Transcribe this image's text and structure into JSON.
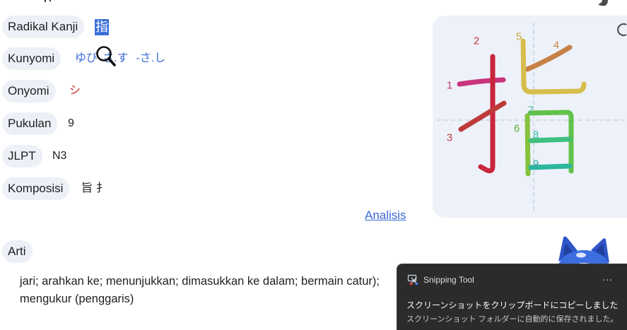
{
  "colors": {
    "text": "#202124",
    "pill_bg": "#edf0f7",
    "radical_highlight": "#3a6fd8",
    "kunyomi": "#3a6bd6",
    "onyomi": "#c62828",
    "link": "#3b67d4",
    "diagram_bg": "#edf1f9",
    "diagram_guide": "#b7c3d7",
    "notification_bg": "#2b2b2b",
    "notification_text": "#ffffff",
    "notification_subtext": "#c8c8c8",
    "mascot": "#3d6ee0"
  },
  "details": {
    "radical": {
      "label": "Radikal Kanji",
      "value": "指"
    },
    "kunyomi": {
      "label": "Kunyomi",
      "readings": [
        "ゆび",
        "さ.す",
        "-さ.し"
      ]
    },
    "onyomi": {
      "label": "Onyomi",
      "value": "シ"
    },
    "strokes": {
      "label": "Pukulan",
      "value": "9"
    },
    "jlpt": {
      "label": "JLPT",
      "value": "N3"
    },
    "composition": {
      "label": "Komposisi",
      "parts": [
        "旨",
        "扌"
      ]
    }
  },
  "analysis_link": "Analisis",
  "meaning": {
    "label": "Arti",
    "lines": [
      "jari; arahkan ke; menunjukkan; dimasukkan ke dalam; bermain catur);",
      "mengukur (penggaris)"
    ]
  },
  "stroke_diagram": {
    "replay_icon": "replay-icon",
    "strokes": [
      {
        "label": "1",
        "color": "#c8347d",
        "label_color": "#c63c78"
      },
      {
        "label": "2",
        "color": "#c8263c",
        "label_color": "#c43b3d"
      },
      {
        "label": "3",
        "color": "#bd3a3a",
        "label_color": "#c0443f"
      },
      {
        "label": "4",
        "color": "#c68146",
        "label_color": "#c8863f"
      },
      {
        "label": "5",
        "color": "#d6bd4c",
        "label_color": "#c9ab3c"
      },
      {
        "label": "6",
        "color": "#86c23e",
        "label_color": "#5daf3f"
      },
      {
        "label": "7",
        "color": "#62c14b",
        "label_color": "#45b7a5"
      },
      {
        "label": "8",
        "color": "#3fbf7d",
        "label_color": "#3cb7a9"
      },
      {
        "label": "9",
        "color": "#2db59e",
        "label_color": "#32aaa6"
      }
    ]
  },
  "cursor_icon": "magnifier-cursor-icon",
  "mascot_icon": "mascot-icon",
  "notification": {
    "icon": "snipping-tool-icon",
    "app_name": "Snipping Tool",
    "more_label": "···",
    "message": "スクリーンショットをクリップボードにコピーしました",
    "detail": "スクリーンショット フォルダーに自動的に保存されました。"
  }
}
